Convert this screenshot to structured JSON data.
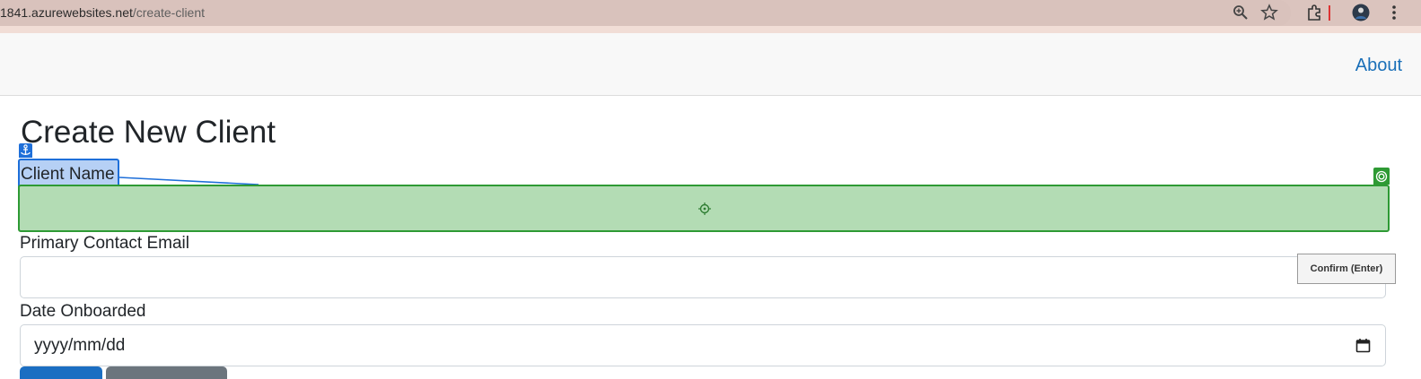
{
  "browser": {
    "url_host": "1841.azurewebsites.net",
    "url_path": "/create-client",
    "icons": [
      "zoom-icon",
      "star-icon",
      "extensions-icon",
      "profile-avatar",
      "menu-icon"
    ]
  },
  "navbar": {
    "about_label": "About"
  },
  "page": {
    "title": "Create New Client"
  },
  "form": {
    "client_name_label": "Client Name",
    "client_name_value": "",
    "email_label": "Primary Contact Email",
    "email_value": "",
    "date_label": "Date Onboarded",
    "date_placeholder": "yyyy/mm/dd"
  },
  "overlay": {
    "confirm_label": "Confirm (Enter)"
  },
  "colors": {
    "link": "#1a6fb8",
    "annotation_blue": "#1e6fd9",
    "annotation_green": "#2e9a34",
    "primary_button": "#1b6ec2",
    "secondary_button": "#6c757d"
  }
}
